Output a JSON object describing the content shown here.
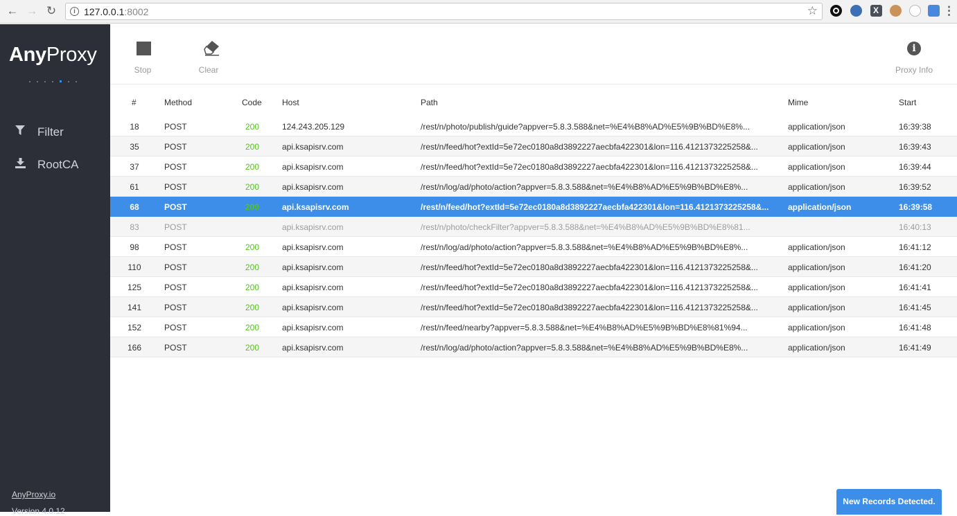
{
  "browser": {
    "url_host": "127.0.0.1",
    "url_port": ":8002"
  },
  "sidebar": {
    "logo_bold": "Any",
    "logo_light": "Proxy",
    "items": [
      {
        "label": "Filter",
        "icon": "filter-icon"
      },
      {
        "label": "RootCA",
        "icon": "download-icon"
      }
    ],
    "footer_link": "AnyProxy.io",
    "version": "Version 4.0.12"
  },
  "toolbar": {
    "stop_label": "Stop",
    "clear_label": "Clear",
    "proxy_info_label": "Proxy Info"
  },
  "table": {
    "headers": {
      "id": "#",
      "method": "Method",
      "code": "Code",
      "host": "Host",
      "path": "Path",
      "mime": "Mime",
      "start": "Start"
    },
    "rows": [
      {
        "id": "18",
        "method": "POST",
        "code": "200",
        "host": "124.243.205.129",
        "path": "/rest/n/photo/publish/guide?appver=5.8.3.588&net=%E4%B8%AD%E5%9B%BD%E8%...",
        "mime": "application/json",
        "start": "16:39:38"
      },
      {
        "id": "35",
        "method": "POST",
        "code": "200",
        "host": "api.ksapisrv.com",
        "path": "/rest/n/feed/hot?extId=5e72ec0180a8d3892227aecbfa422301&lon=116.4121373225258&...",
        "mime": "application/json",
        "start": "16:39:43"
      },
      {
        "id": "37",
        "method": "POST",
        "code": "200",
        "host": "api.ksapisrv.com",
        "path": "/rest/n/feed/hot?extId=5e72ec0180a8d3892227aecbfa422301&lon=116.4121373225258&...",
        "mime": "application/json",
        "start": "16:39:44"
      },
      {
        "id": "61",
        "method": "POST",
        "code": "200",
        "host": "api.ksapisrv.com",
        "path": "/rest/n/log/ad/photo/action?appver=5.8.3.588&net=%E4%B8%AD%E5%9B%BD%E8%...",
        "mime": "application/json",
        "start": "16:39:52"
      },
      {
        "id": "68",
        "method": "POST",
        "code": "200",
        "host": "api.ksapisrv.com",
        "path": "/rest/n/feed/hot?extId=5e72ec0180a8d3892227aecbfa422301&lon=116.4121373225258&...",
        "mime": "application/json",
        "start": "16:39:58"
      },
      {
        "id": "83",
        "method": "POST",
        "code": "",
        "host": "api.ksapisrv.com",
        "path": "/rest/n/photo/checkFilter?appver=5.8.3.588&net=%E4%B8%AD%E5%9B%BD%E8%81...",
        "mime": "",
        "start": "16:40:13"
      },
      {
        "id": "98",
        "method": "POST",
        "code": "200",
        "host": "api.ksapisrv.com",
        "path": "/rest/n/log/ad/photo/action?appver=5.8.3.588&net=%E4%B8%AD%E5%9B%BD%E8%...",
        "mime": "application/json",
        "start": "16:41:12"
      },
      {
        "id": "110",
        "method": "POST",
        "code": "200",
        "host": "api.ksapisrv.com",
        "path": "/rest/n/feed/hot?extId=5e72ec0180a8d3892227aecbfa422301&lon=116.4121373225258&...",
        "mime": "application/json",
        "start": "16:41:20"
      },
      {
        "id": "125",
        "method": "POST",
        "code": "200",
        "host": "api.ksapisrv.com",
        "path": "/rest/n/feed/hot?extId=5e72ec0180a8d3892227aecbfa422301&lon=116.4121373225258&...",
        "mime": "application/json",
        "start": "16:41:41"
      },
      {
        "id": "141",
        "method": "POST",
        "code": "200",
        "host": "api.ksapisrv.com",
        "path": "/rest/n/feed/hot?extId=5e72ec0180a8d3892227aecbfa422301&lon=116.4121373225258&...",
        "mime": "application/json",
        "start": "16:41:45"
      },
      {
        "id": "152",
        "method": "POST",
        "code": "200",
        "host": "api.ksapisrv.com",
        "path": "/rest/n/feed/nearby?appver=5.8.3.588&net=%E4%B8%AD%E5%9B%BD%E8%81%94...",
        "mime": "application/json",
        "start": "16:41:48"
      },
      {
        "id": "166",
        "method": "POST",
        "code": "200",
        "host": "api.ksapisrv.com",
        "path": "/rest/n/log/ad/photo/action?appver=5.8.3.588&net=%E4%B8%AD%E5%9B%BD%E8%...",
        "mime": "application/json",
        "start": "16:41:49"
      }
    ],
    "selected_row": 4,
    "pending_rows": [
      5
    ]
  },
  "toast": "New Records Detected.",
  "colors": {
    "sidebar_bg": "#2c2f38",
    "accent": "#3d8ee8",
    "status_ok": "#52c41a"
  }
}
